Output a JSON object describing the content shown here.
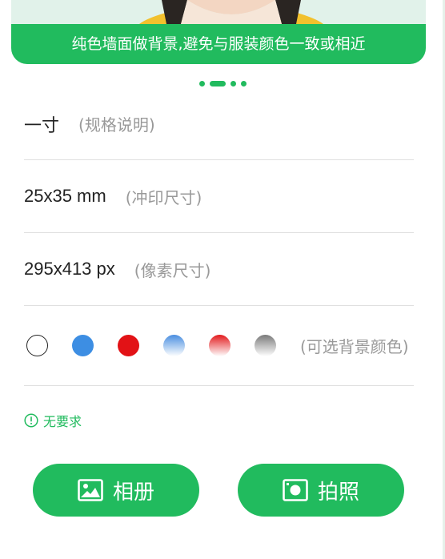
{
  "banner": {
    "caption": "纯色墙面做背景,避免与服装颜色一致或相近"
  },
  "carousel": {
    "dot_count": 4,
    "active_index": 1
  },
  "specs": {
    "name": "一寸",
    "name_note": "(规格说明)",
    "print_size": "25x35 mm",
    "print_size_note": "(冲印尺寸)",
    "pixel_size": "295x413 px",
    "pixel_size_note": "(像素尺寸)"
  },
  "backgrounds": {
    "note": "(可选背景颜色)",
    "options": [
      {
        "name": "white",
        "color": "#ffffff"
      },
      {
        "name": "blue",
        "color": "#3d8ee3"
      },
      {
        "name": "red",
        "color": "#e21216"
      },
      {
        "name": "blue-gradient",
        "color": "#4a8ee0"
      },
      {
        "name": "red-gradient",
        "color": "#e21a1c"
      },
      {
        "name": "gray-gradient",
        "color": "#7a7a7a"
      }
    ]
  },
  "requirement": {
    "icon": "info-circle-icon",
    "text": "无要求"
  },
  "actions": {
    "album_label": "相册",
    "album_icon": "image-icon",
    "camera_label": "拍照",
    "camera_icon": "camera-icon"
  },
  "colors": {
    "accent": "#21bb5e",
    "note_text": "#999999"
  }
}
